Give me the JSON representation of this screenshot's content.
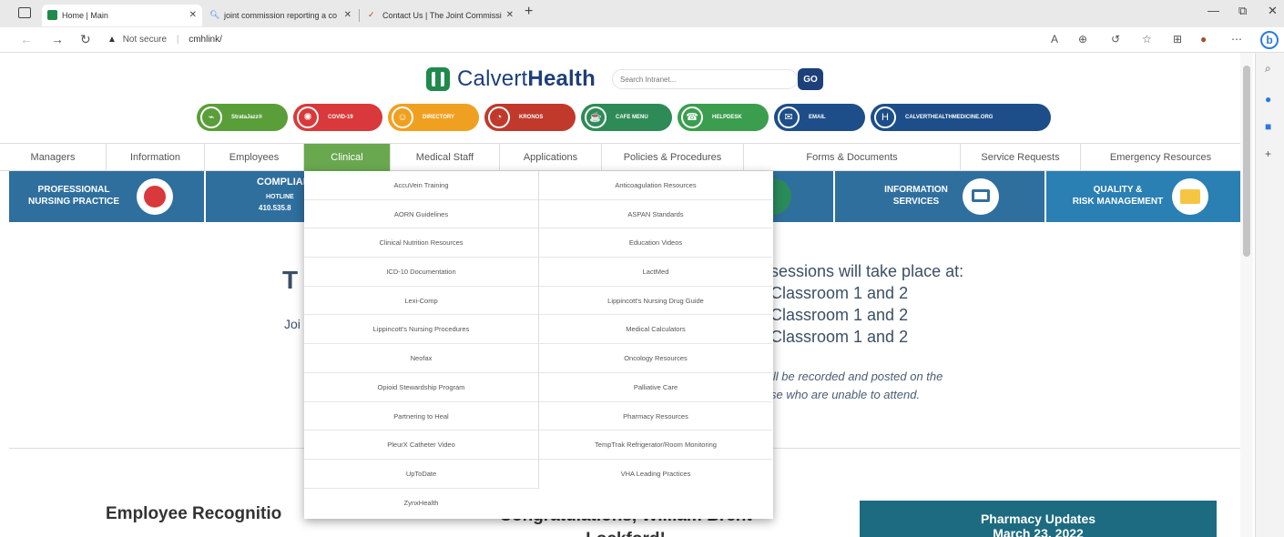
{
  "browser": {
    "tabs": [
      {
        "title": "Home | Main",
        "active": true
      },
      {
        "title": "joint commission reporting a co",
        "active": false
      },
      {
        "title": "Contact Us | The Joint Commissi",
        "active": false
      }
    ],
    "address": {
      "security": "Not secure",
      "url": "cmhlink/"
    }
  },
  "header": {
    "logo_light": "Calvert",
    "logo_bold": "Health",
    "search_placeholder": "Search Intranet...",
    "go_label": "GO"
  },
  "quick_links": [
    {
      "label": "StrataJazz®",
      "color": "#5a9e3a",
      "icon": "strata-icon"
    },
    {
      "label": "COVID-19",
      "color": "#d9393a",
      "icon": "virus-icon"
    },
    {
      "label": "DIRECTORY",
      "color": "#f0a020",
      "icon": "person-icon"
    },
    {
      "label": "KRONOS",
      "color": "#c0392b",
      "icon": "clock-icon"
    },
    {
      "label": "CAFE MENU",
      "color": "#2e8b57",
      "icon": "cafe-icon"
    },
    {
      "label": "HELPDESK",
      "color": "#3a9e4e",
      "icon": "helpdesk-icon"
    },
    {
      "label": "EMAIL",
      "color": "#1d4e89",
      "icon": "email-icon"
    },
    {
      "label": "CALVERTHEALTHMEDICINE.ORG",
      "color": "#1d4e89",
      "icon": "calvert-icon"
    }
  ],
  "nav": [
    "Managers",
    "Information",
    "Employees",
    "Clinical",
    "Medical Staff",
    "Applications",
    "Policies & Procedures",
    "Forms & Documents",
    "Service Requests",
    "Emergency Resources"
  ],
  "banners": {
    "nursing": "PROFESSIONAL\nNURSING PRACTICE",
    "compliance_title": "COMPLIAN",
    "compliance_sub": "HOTLINE",
    "compliance_phone": "410.535.8",
    "info_services": "INFORMATION\nSERVICES",
    "quality": "QUALITY &\nRISK MANAGEMENT"
  },
  "content": {
    "partial_heading": "T",
    "partial_join": "Joi",
    "session_lines": [
      "sessions will take place at:",
      "Classroom 1 and 2",
      "Classroom 1 and 2",
      "Classroom 1 and 2"
    ],
    "note_lines": [
      "ill be recorded and posted on the",
      "se who are unable to attend."
    ],
    "employee_recognition": "Employee Recognitio",
    "congrats_line1": "Congratulations, William Brent",
    "congrats_line2": "Lockford!",
    "pharmacy_title": "Pharmacy Updates",
    "pharmacy_date": "March 23, 2022"
  },
  "clinical_menu": {
    "left": [
      "AccuVein Training",
      "AORN Guidelines",
      "Clinical Nutrition Resources",
      "ICD-10 Documentation",
      "Lexi-Comp",
      "Lippincott's Nursing Procedures",
      "Neofax",
      "Opioid Stewardship Program",
      "Partnering to Heal",
      "PleurX Catheter Video",
      "UpToDate",
      "ZynxHealth"
    ],
    "right": [
      "Anticoagulation Resources",
      "ASPAN Standards",
      "Education Videos",
      "LactMed",
      "Lippincott's Nursing Drug Guide",
      "Medical Calculators",
      "Oncology Resources",
      "Palliative Care",
      "Pharmacy Resources",
      "TempTrak Refrigerator/Room Monitoring",
      "VHA Leading Practices"
    ]
  }
}
